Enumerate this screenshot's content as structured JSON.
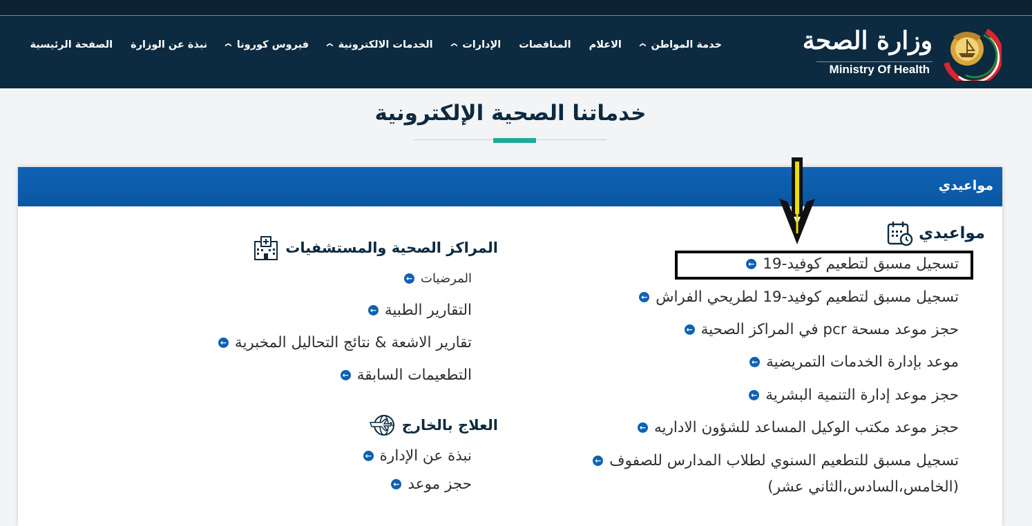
{
  "header": {
    "logo_arabic": "وزارة الصحة",
    "logo_english": "Ministry Of Health",
    "nav": [
      {
        "label": "الصفحة الرئيسية",
        "dropdown": false
      },
      {
        "label": "نبذة عن الوزارة",
        "dropdown": false
      },
      {
        "label": "فيروس كورونا",
        "dropdown": true
      },
      {
        "label": "الخدمات الالكترونية",
        "dropdown": true
      },
      {
        "label": "الإدارات",
        "dropdown": true
      },
      {
        "label": "المناقصات",
        "dropdown": false
      },
      {
        "label": "الاعلام",
        "dropdown": false
      },
      {
        "label": "خدمة المواطن",
        "dropdown": true
      }
    ]
  },
  "page": {
    "title": "خدماتنا الصحية الإلكترونية"
  },
  "card": {
    "header_title": "مواعيدي",
    "appointments": {
      "title": "مواعيدي",
      "links": [
        "تسجيل مسبق لتطعيم كوفيد-19",
        "تسجيل مسبق لتطعيم كوفيد-19 لطريحي الفراش",
        "حجز موعد مسحة pcr في المراكز الصحية",
        "موعد بإدارة الخدمات التمريضية",
        "حجز موعد إدارة التنمية البشرية",
        "حجز موعد مكتب الوكيل المساعد للشؤون الاداريه",
        "تسجيل مسبق للتطعيم السنوي لطلاب المدارس للصفوف",
        "(الخامس،السادس،الثاني عشر)"
      ]
    },
    "health_centers": {
      "title": "المراكز الصحية والمستشفيات",
      "links": [
        "المرضيات",
        "التقارير الطبية",
        "تقارير الاشعة & نتائج التحاليل المخبرية",
        "التطعيمات السابقة"
      ]
    },
    "treatment_abroad": {
      "title": "العلاج بالخارج",
      "links": [
        "نبذة عن الإدارة",
        "حجز موعد"
      ]
    }
  },
  "icons": {
    "bullet": "arrow-circle-left-icon",
    "appointments": "calendar-clock-icon",
    "health_centers": "hospital-building-icon",
    "treatment_abroad": "globe-plane-icon",
    "annotation": "down-arrow-icon"
  },
  "colors": {
    "navbar": "#0c2a40",
    "card_header": "#0f62b4",
    "accent": "#1bab98",
    "bullet": "#0e61b3",
    "annotation_arrow": "#e8e000"
  }
}
